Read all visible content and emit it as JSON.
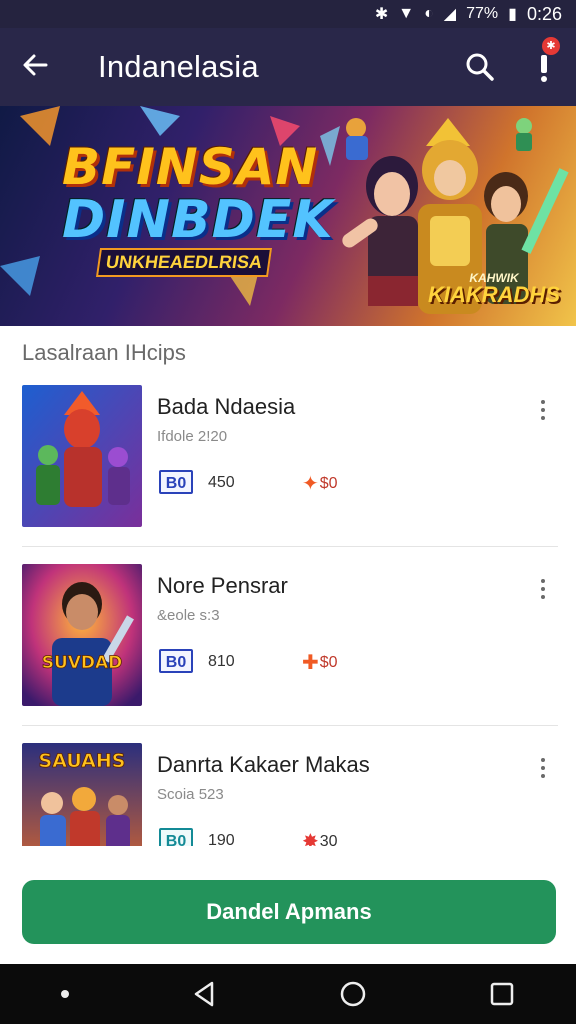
{
  "status_bar": {
    "battery": "77%",
    "time": "0:26"
  },
  "app_bar": {
    "title": "Indanelasia"
  },
  "banner": {
    "title_line1": "BFINSAN",
    "title_line2": "DINBDEK",
    "subtitle": "UNKHEAEDLRISA",
    "badge_text": "KIAKRADHS",
    "badge_small": "KAHWIK"
  },
  "section": {
    "title": "Lasalraan IHcips"
  },
  "items": [
    {
      "title": "Bada Ndaesia",
      "subtitle": "Ifdole 2!20",
      "badge": "B0",
      "count": "450",
      "reward": "$0",
      "badge_color": "blue"
    },
    {
      "title": "Nore Pensrar",
      "subtitle": "&eole s:3",
      "badge": "B0",
      "count": "810",
      "reward": "$0",
      "badge_color": "blue"
    },
    {
      "title": "Danrta Kakaer Makas",
      "subtitle": "Scoia 523",
      "badge": "B0",
      "count": "190",
      "reward": "30",
      "badge_color": "teal"
    }
  ],
  "thumb_texts": {
    "item2": "SUVDAD",
    "item3": "SAUAHS"
  },
  "cta": {
    "label": "Dandel Apmans"
  },
  "colors": {
    "app_bar": "#292749",
    "cta": "#23935b",
    "badge_blue": "#2a42b9",
    "badge_teal": "#138a96"
  }
}
